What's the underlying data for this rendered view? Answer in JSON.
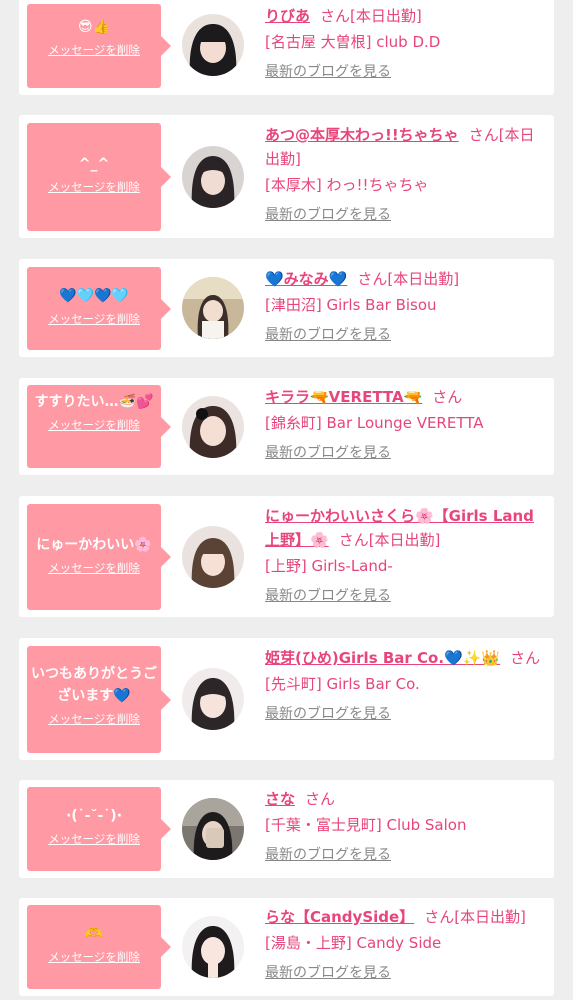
{
  "delete_label": "メッセージを削除",
  "blog_label": "最新のブログを見る",
  "colors": {
    "accent": "#e8457a",
    "message_bubble": "#ff99a3",
    "background": "#eeeeee",
    "blog_link": "#888888"
  },
  "entries": [
    {
      "message": "😎👍",
      "name": "りびあ",
      "suffix": "さん[本日出勤]",
      "shop": "[名古屋 大曽根] club D.D"
    },
    {
      "message": "^_^",
      "name": "あつ@本厚木わっ!!ちゃちゃ",
      "suffix": "さん[本日出勤]",
      "shop": "[本厚木] わっ!!ちゃちゃ"
    },
    {
      "message": "💙🩵💙🩵",
      "name": "💙みなみ💙",
      "suffix": "さん[本日出勤]",
      "shop": "[津田沼] Girls Bar Bisou"
    },
    {
      "message": "すすりたい…🍜💕",
      "name": "キララ🔫VERETTA🔫",
      "suffix": "さん",
      "shop": "[錦糸町] Bar Lounge VERETTA"
    },
    {
      "message": "にゅーかわいい🌸",
      "name": "にゅーかわいいさくら🌸【Girls Land上野】🌸",
      "suffix": "さん[本日出勤]",
      "shop": "[上野] Girls-Land-"
    },
    {
      "message": "いつもありがとうございます💙",
      "name": "姫芽(ひめ)Girls Bar Co.💙✨👑",
      "suffix": "さん",
      "shop": "[先斗町] Girls Bar Co."
    },
    {
      "message": "·(˙-˘-˙)·",
      "name": "さな",
      "suffix": "さん",
      "shop": "[千葉・富士見町] Club Salon"
    },
    {
      "message": "🫶",
      "name": "らな【CandySide】",
      "suffix": "さん[本日出勤]",
      "shop": "[湯島・上野] Candy Side"
    }
  ]
}
